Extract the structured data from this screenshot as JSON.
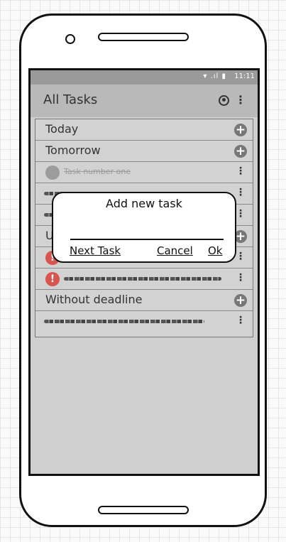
{
  "status": {
    "time": "11:11",
    "icons": "▾ .ıl ▮"
  },
  "appbar": {
    "title": "All Tasks",
    "menu_label": "⋮"
  },
  "sections": {
    "today": "Today",
    "tomorrow": "Tomorrow",
    "upcoming_partial": "U",
    "without_deadline": "Without deadline"
  },
  "tasks": {
    "first": "Task number one",
    "alert_mark": "!"
  },
  "plus_symbol": "+",
  "kebab_symbol": "⋮",
  "dialog": {
    "title": "Add new task",
    "input_value": "",
    "next_label": "Next Task",
    "cancel_label": "Cancel",
    "ok_label": "Ok"
  },
  "colors": {
    "alert": "#d9534f",
    "screen_bg": "#cfcfcf",
    "appbar_bg": "#b9b9b9"
  }
}
